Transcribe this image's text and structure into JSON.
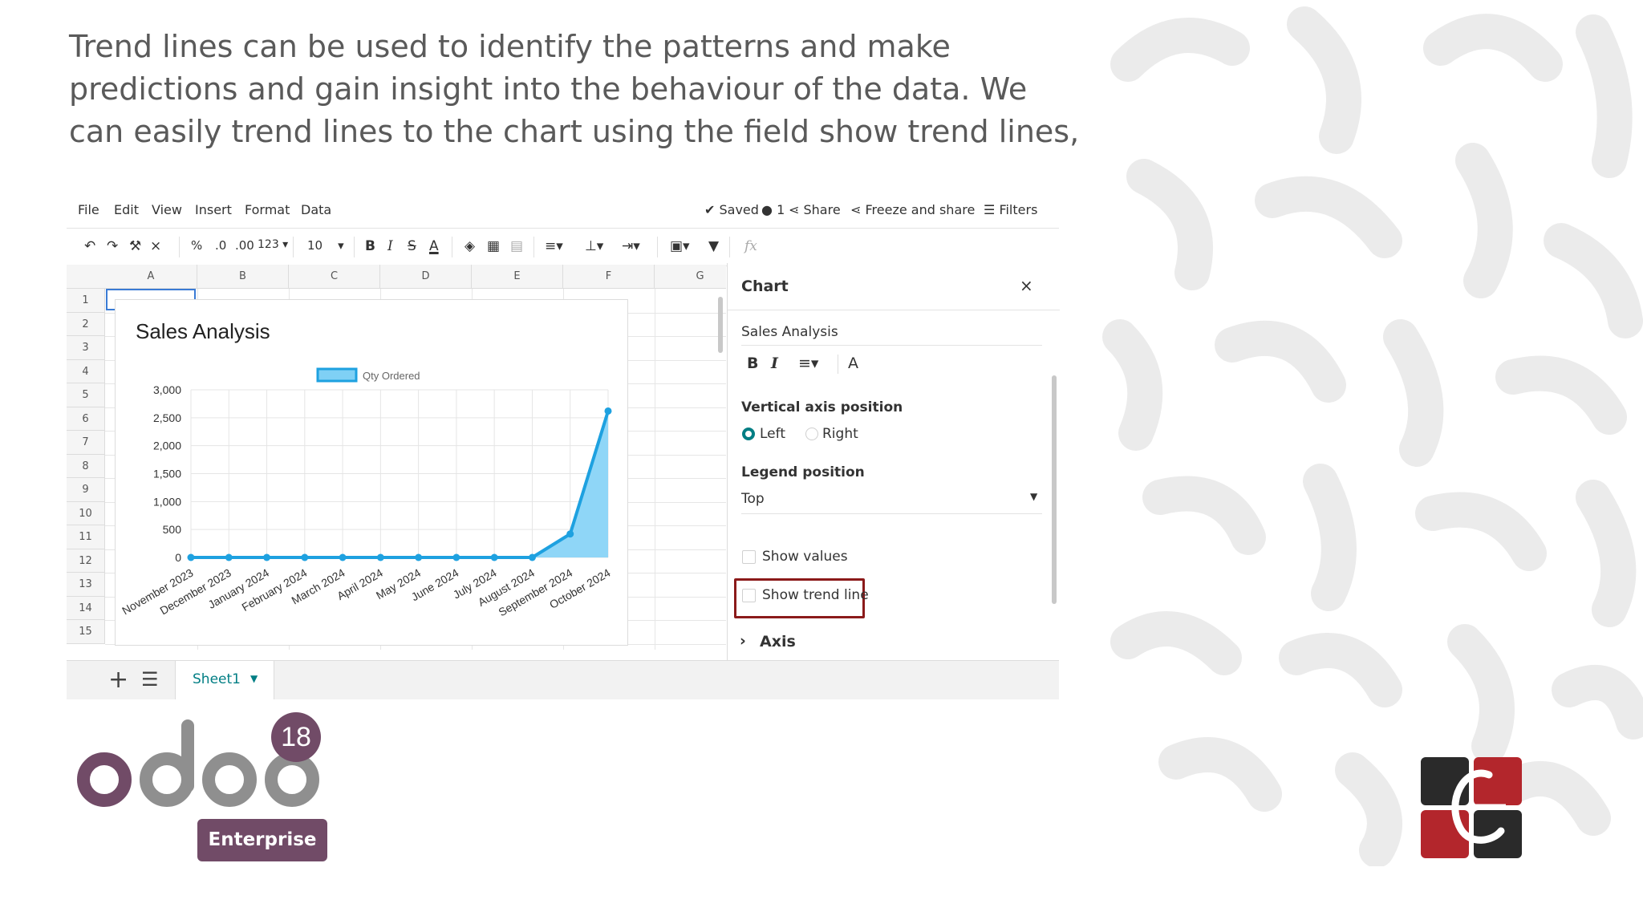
{
  "intro_text": "Trend lines can be used to identify the patterns and make predictions and gain insight into the behaviour of the data. We can easily trend lines to the chart using the field show trend lines,",
  "menu": [
    "File",
    "Edit",
    "View",
    "Insert",
    "Format",
    "Data"
  ],
  "header_actions": {
    "saved": "Saved",
    "users": "1",
    "share": "Share",
    "freeze_share": "Freeze and share",
    "filters": "Filters"
  },
  "toolbar": {
    "percent": "%",
    "dec_less": ".0",
    "dec_more": ".00",
    "format_123": "123",
    "font_size": "10",
    "fx": "fx"
  },
  "grid": {
    "columns": [
      "A",
      "B",
      "C",
      "D",
      "E",
      "F",
      "G"
    ],
    "rows": [
      "1",
      "2",
      "3",
      "4",
      "5",
      "6",
      "7",
      "8",
      "9",
      "10",
      "11",
      "12",
      "13",
      "14",
      "15"
    ]
  },
  "chart_data": {
    "type": "area",
    "title": "Sales Analysis",
    "legend": "Qty Ordered",
    "legend_position": "top",
    "categories": [
      "November 2023",
      "December 2023",
      "January 2024",
      "February 2024",
      "March 2024",
      "April 2024",
      "May 2024",
      "June 2024",
      "July 2024",
      "August 2024",
      "September 2024",
      "October 2024"
    ],
    "series": [
      {
        "name": "Qty Ordered",
        "values": [
          0,
          0,
          0,
          0,
          0,
          0,
          0,
          0,
          0,
          0,
          420,
          2620
        ]
      }
    ],
    "ylim": [
      0,
      3000
    ],
    "yticks": [
      "0",
      "500",
      "1,000",
      "1,500",
      "2,000",
      "2,500",
      "3,000"
    ],
    "grid": true,
    "color": "#1ea1e0"
  },
  "panel": {
    "title": "Chart",
    "close": "×",
    "chart_title_value": "Sales Analysis",
    "vertical_axis_label": "Vertical axis position",
    "axis_left": "Left",
    "axis_right": "Right",
    "legend_position_label": "Legend position",
    "legend_position_value": "Top",
    "show_values": "Show values",
    "show_trend_line": "Show trend line",
    "axis_section": "Axis"
  },
  "sheet_tab": "Sheet1",
  "branding": {
    "odoo_version": "18",
    "edition": "Enterprise"
  },
  "colors": {
    "odoo_purple": "#714b67",
    "highlight_border": "#8b1a1a",
    "chart_blue": "#1ea1e0"
  }
}
